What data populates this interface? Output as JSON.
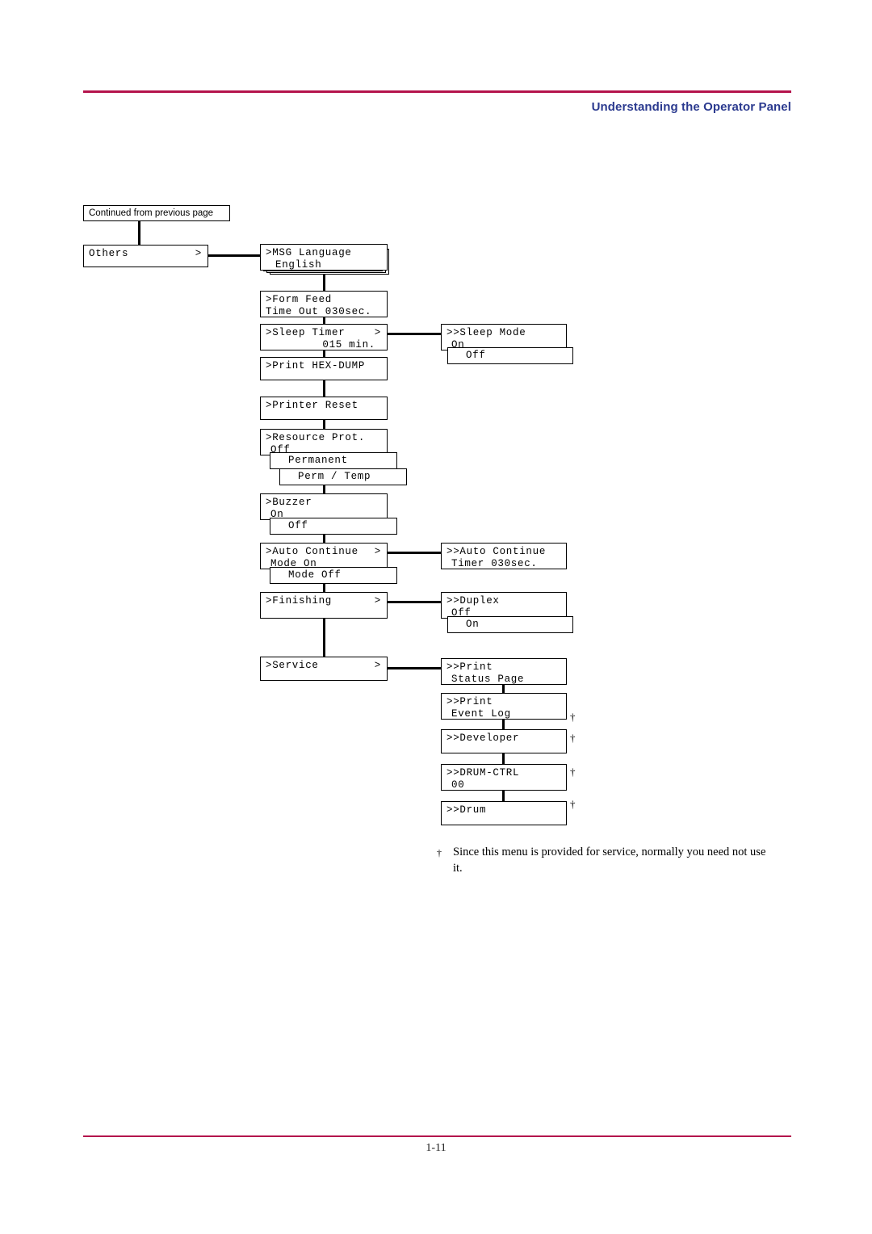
{
  "header": {
    "title": "Understanding the Operator Panel",
    "rule_color": "#b4134c",
    "title_color": "#2b3a8f"
  },
  "footer": {
    "page_number": "1-11"
  },
  "diagram": {
    "continued_label": "Continued from previous page",
    "nodes": {
      "others": {
        "line1": "Others",
        "arrow": ">"
      },
      "msg_language": {
        "line1": ">MSG Language",
        "line2": "English"
      },
      "form_feed": {
        "line1": ">Form Feed",
        "line2": "Time Out 030sec."
      },
      "sleep_timer": {
        "line1": ">Sleep Timer",
        "arrow": ">",
        "line2": "015 min."
      },
      "sleep_mode": {
        "line1": ">>Sleep Mode",
        "line2": "On"
      },
      "sleep_mode_off": {
        "line1": "Off"
      },
      "print_hex_dump": {
        "line1": ">Print HEX-DUMP"
      },
      "printer_reset": {
        "line1": ">Printer Reset"
      },
      "resource_prot": {
        "line1": ">Resource Prot.",
        "line2": "Off"
      },
      "resource_permanent": {
        "line1": "Permanent"
      },
      "resource_perm_temp": {
        "line1": "Perm / Temp"
      },
      "buzzer": {
        "line1": ">Buzzer",
        "line2": "On"
      },
      "buzzer_off": {
        "line1": "Off"
      },
      "auto_continue": {
        "line1": ">Auto Continue",
        "arrow": ">",
        "line2": "Mode    On"
      },
      "auto_continue_mode_off": {
        "line1": "Mode    Off"
      },
      "auto_continue_timer": {
        "line1": ">>Auto Continue",
        "line2": "Timer 030sec."
      },
      "finishing": {
        "line1": ">Finishing",
        "arrow": ">"
      },
      "duplex": {
        "line1": ">>Duplex",
        "line2": "Off"
      },
      "duplex_on": {
        "line1": "On"
      },
      "service": {
        "line1": ">Service",
        "arrow": ">"
      },
      "print_status_page": {
        "line1": ">>Print",
        "line2": "Status Page"
      },
      "print_event_log": {
        "line1": ">>Print",
        "line2": "Event Log"
      },
      "developer": {
        "line1": ">>Developer"
      },
      "drum_ctrl": {
        "line1": ">>DRUM-CTRL",
        "line2": "00"
      },
      "drum": {
        "line1": ">>Drum"
      }
    },
    "daggers": [
      "†",
      "†",
      "†",
      "†"
    ],
    "footnote": {
      "mark": "†",
      "text": "Since this menu is provided for service, normally you need not use it."
    }
  }
}
